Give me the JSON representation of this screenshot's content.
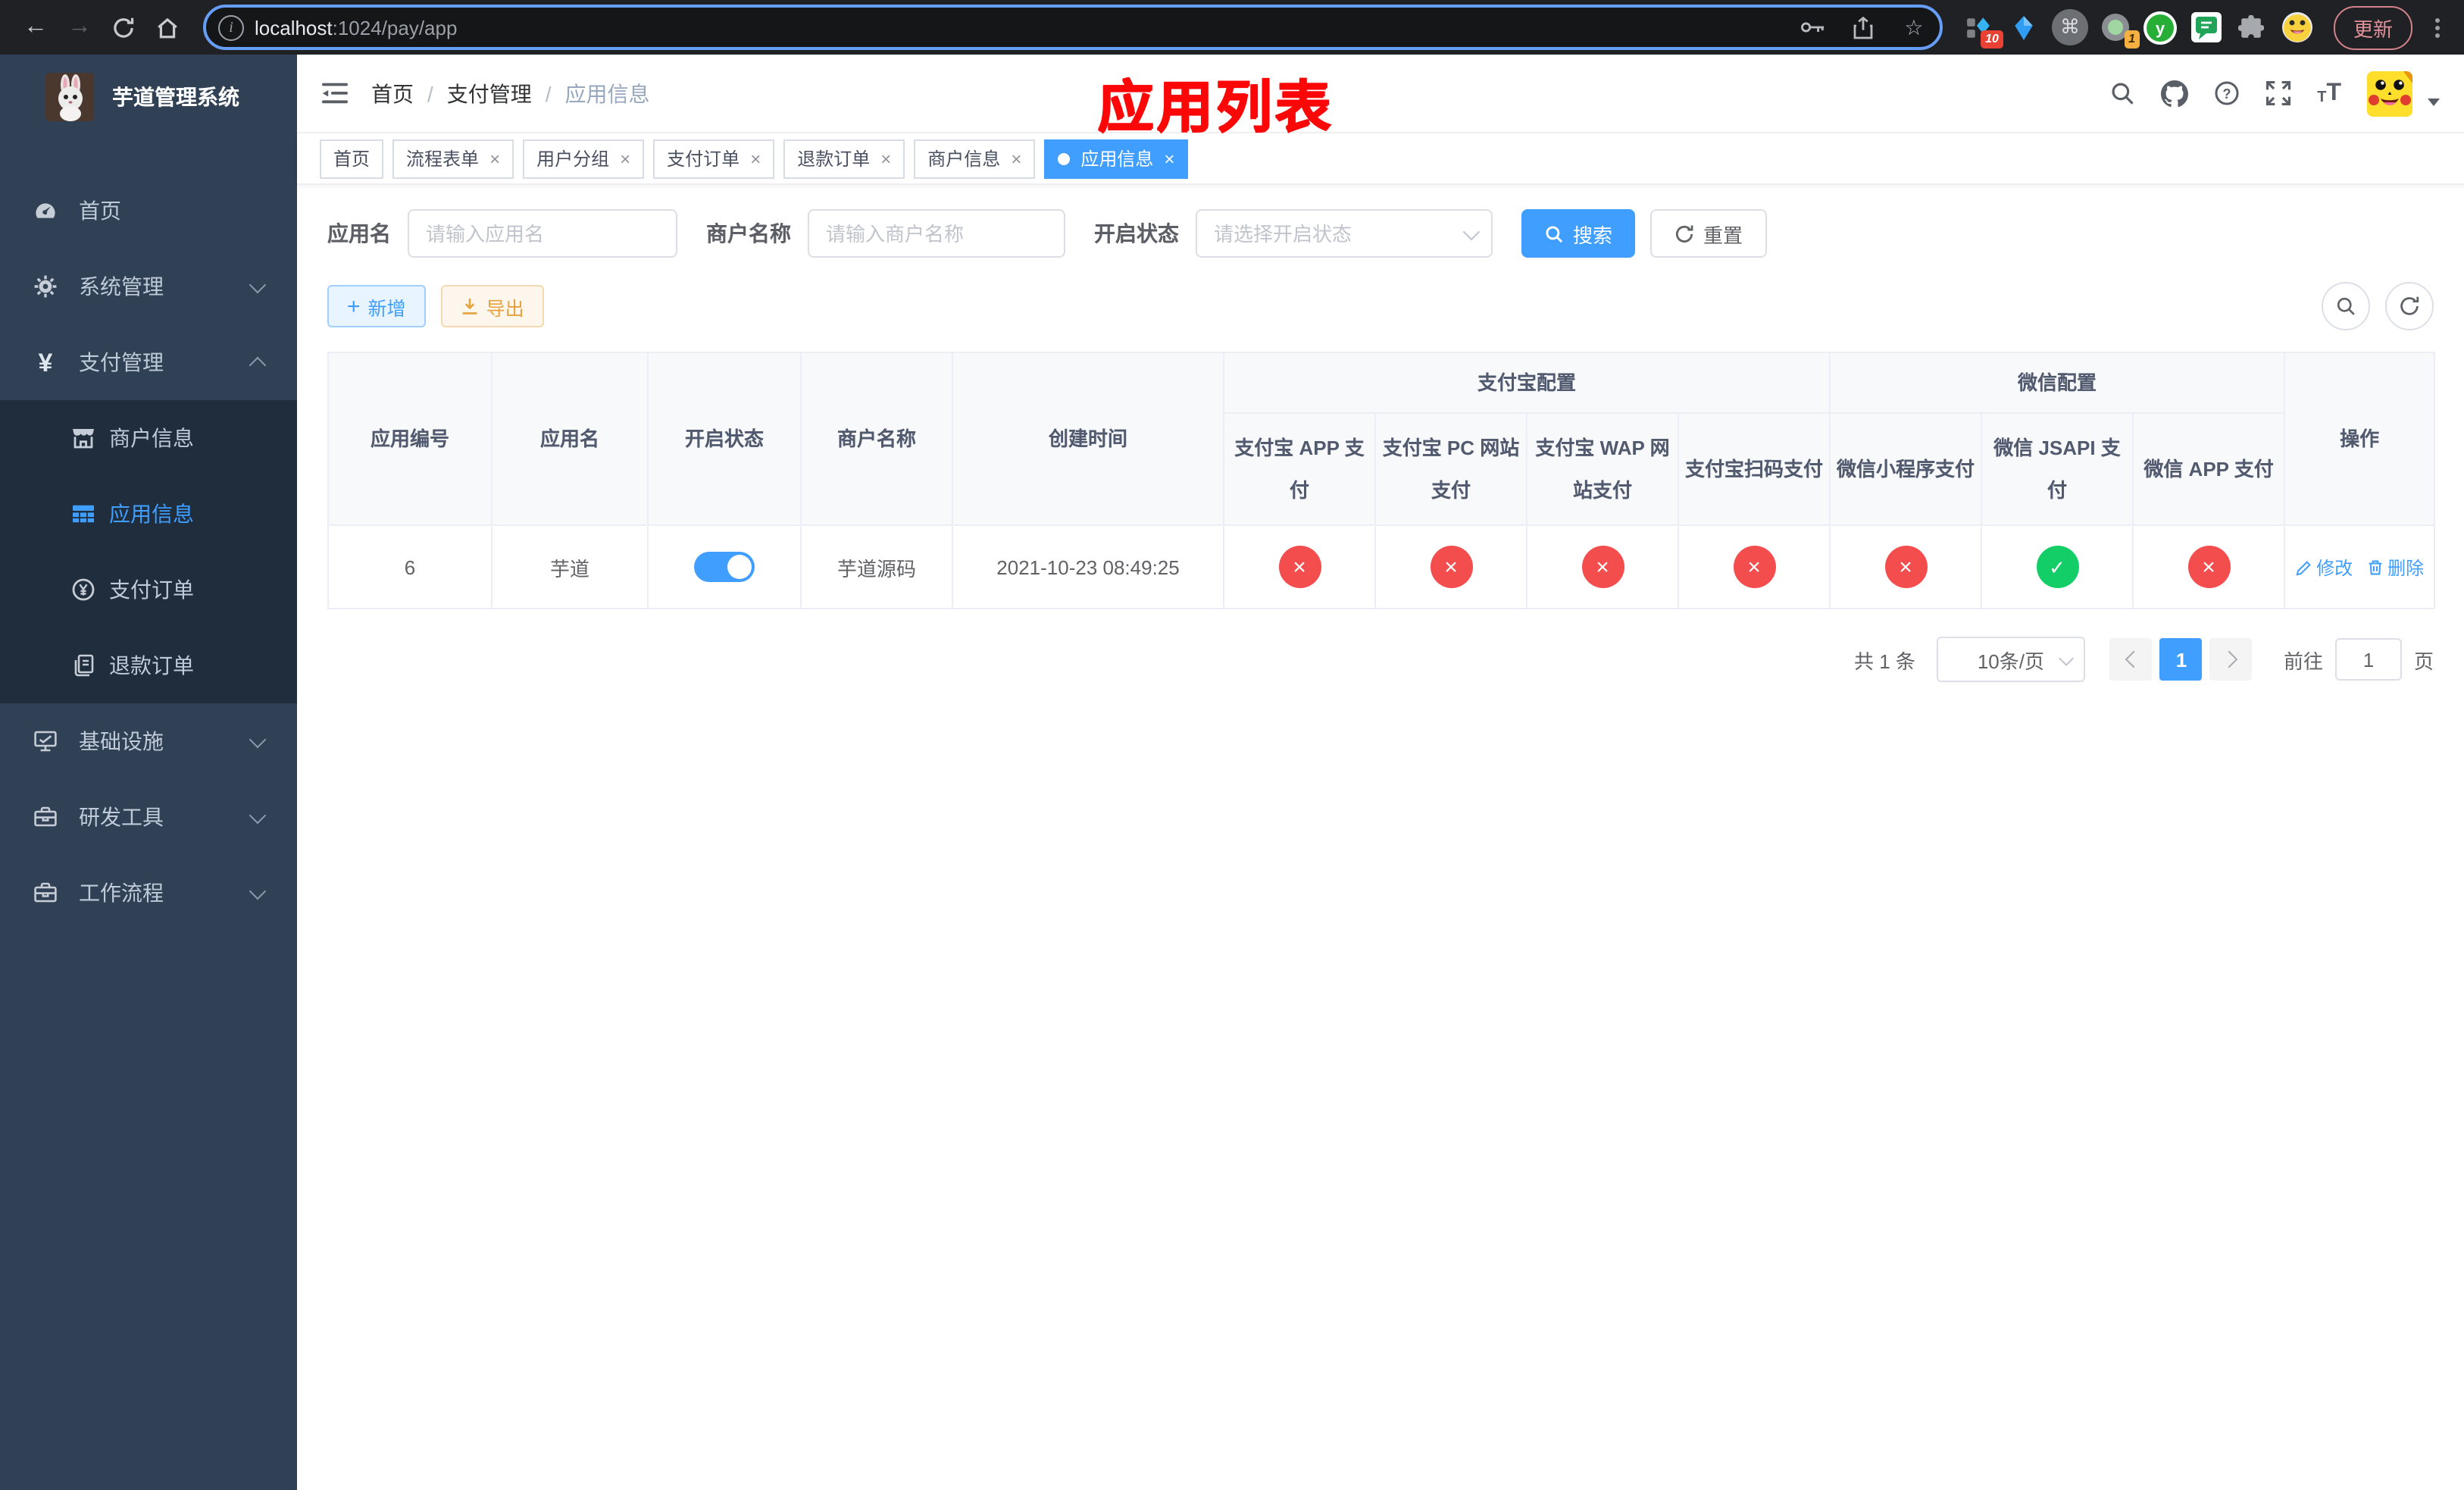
{
  "browser": {
    "url_host": "localhost",
    "url_rest": ":1024/pay/app",
    "update_label": "更新",
    "ext_badge_tasks": "10",
    "ext_badge_tab": "1",
    "icons": [
      "back-icon",
      "forward-icon",
      "reload-icon",
      "home-icon",
      "site-info-icon",
      "key-icon",
      "share-icon",
      "star-icon",
      "puzzle-icon",
      "menu-dots-icon"
    ]
  },
  "sidebar": {
    "title": "芋道管理系统",
    "items": [
      {
        "label": "首页",
        "icon": "dashboard-icon"
      },
      {
        "label": "系统管理",
        "icon": "gear-icon",
        "chevron": "down"
      },
      {
        "label": "支付管理",
        "icon": "yen-icon",
        "chevron": "up",
        "expanded": true
      },
      {
        "label": "商户信息",
        "icon": "shop-icon",
        "sub": true
      },
      {
        "label": "应用信息",
        "icon": "grid-icon",
        "sub": true,
        "active": true
      },
      {
        "label": "支付订单",
        "icon": "yen-circle-icon",
        "sub": true
      },
      {
        "label": "退款订单",
        "icon": "document-icon",
        "sub": true
      },
      {
        "label": "基础设施",
        "icon": "monitor-icon",
        "chevron": "down"
      },
      {
        "label": "研发工具",
        "icon": "toolbox-icon",
        "chevron": "down"
      },
      {
        "label": "工作流程",
        "icon": "workflow-icon",
        "chevron": "down"
      }
    ]
  },
  "header": {
    "breadcrumb": [
      "首页",
      "支付管理",
      "应用信息"
    ],
    "annotation": "应用列表",
    "icons": [
      "search-icon",
      "github-icon",
      "help-icon",
      "fullscreen-icon",
      "font-size-icon",
      "avatar",
      "caret-down-icon"
    ]
  },
  "tabs": [
    {
      "label": "首页",
      "closable": false,
      "active": false
    },
    {
      "label": "流程表单",
      "closable": true,
      "active": false
    },
    {
      "label": "用户分组",
      "closable": true,
      "active": false
    },
    {
      "label": "支付订单",
      "closable": true,
      "active": false
    },
    {
      "label": "退款订单",
      "closable": true,
      "active": false
    },
    {
      "label": "商户信息",
      "closable": true,
      "active": false
    },
    {
      "label": "应用信息",
      "closable": true,
      "active": true
    }
  ],
  "filters": {
    "app_name_label": "应用名",
    "app_name_placeholder": "请输入应用名",
    "merchant_label": "商户名称",
    "merchant_placeholder": "请输入商户名称",
    "status_label": "开启状态",
    "status_placeholder": "请选择开启状态",
    "search_label": "搜索",
    "reset_label": "重置"
  },
  "toolbar": {
    "add_label": "新增",
    "export_label": "导出"
  },
  "table": {
    "group_headers": {
      "alipay": "支付宝配置",
      "wechat": "微信配置"
    },
    "columns": {
      "id": "应用编号",
      "name": "应用名",
      "status": "开启状态",
      "merchant": "商户名称",
      "created": "创建时间",
      "alipay_app": "支付宝 APP 支付",
      "alipay_pc": "支付宝 PC 网站支付",
      "alipay_wap": "支付宝 WAP 网站支付",
      "alipay_qr": "支付宝扫码支付",
      "wx_mini": "微信小程序支付",
      "wx_jsapi": "微信 JSAPI 支付",
      "wx_app": "微信 APP 支付",
      "action": "操作"
    },
    "rows": [
      {
        "id": "6",
        "name": "芋道",
        "enabled": true,
        "merchant": "芋道源码",
        "created": "2021-10-23 08:49:25",
        "configs": [
          false,
          false,
          false,
          false,
          false,
          true,
          false
        ],
        "edit_label": "修改",
        "delete_label": "删除"
      }
    ]
  },
  "pagination": {
    "total": "共 1 条",
    "per_page": "10条/页",
    "page": "1",
    "goto_prefix": "前往",
    "goto_value": "1",
    "goto_suffix": "页"
  },
  "colors": {
    "accent": "#409eff",
    "danger": "#f34d4e",
    "success": "#13ce66",
    "sidebar_bg": "#304156",
    "submenu_bg": "#1f2d3d",
    "annotation_red": "#fb0708"
  }
}
